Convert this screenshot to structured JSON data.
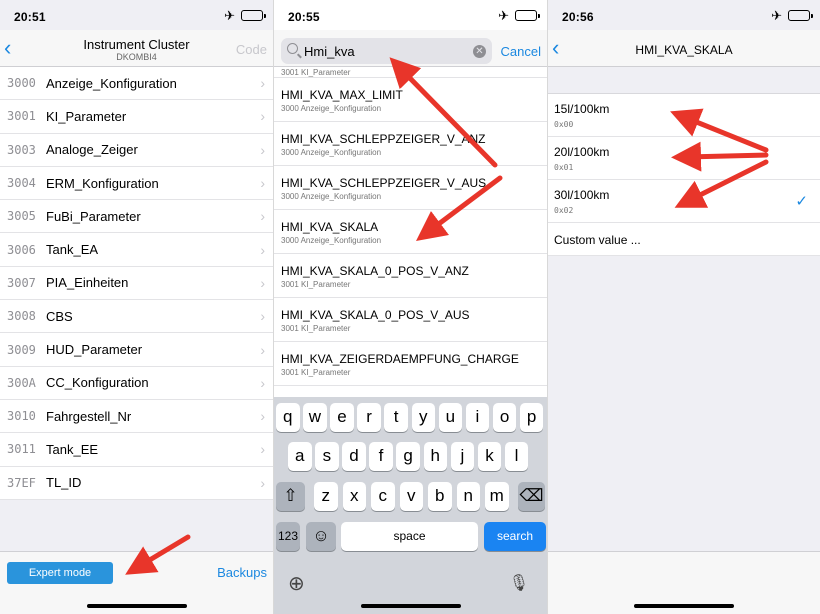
{
  "accent_color": "#1b88e0",
  "arrow_color": "#e8352a",
  "panel1": {
    "status_time": "20:51",
    "nav": {
      "back_icon": "chevron-left-icon",
      "title": "Instrument Cluster",
      "subtitle": "DKOMBI4",
      "code_label": "Code"
    },
    "items": [
      {
        "hex": "3000",
        "name": "Anzeige_Konfiguration"
      },
      {
        "hex": "3001",
        "name": "KI_Parameter"
      },
      {
        "hex": "3003",
        "name": "Analoge_Zeiger"
      },
      {
        "hex": "3004",
        "name": "ERM_Konfiguration"
      },
      {
        "hex": "3005",
        "name": "FuBi_Parameter"
      },
      {
        "hex": "3006",
        "name": "Tank_EA"
      },
      {
        "hex": "3007",
        "name": "PIA_Einheiten"
      },
      {
        "hex": "3008",
        "name": "CBS"
      },
      {
        "hex": "3009",
        "name": "HUD_Parameter"
      },
      {
        "hex": "300A",
        "name": "CC_Konfiguration"
      },
      {
        "hex": "3010",
        "name": "Fahrgestell_Nr"
      },
      {
        "hex": "3011",
        "name": "Tank_EE"
      },
      {
        "hex": "37EF",
        "name": "TL_ID"
      }
    ],
    "expert_label": "Expert mode",
    "backups_label": "Backups"
  },
  "panel2": {
    "status_time": "20:55",
    "search_value": "Hmi_kva",
    "cancel_label": "Cancel",
    "partial_desc": "3001 KI_Parameter",
    "results": [
      {
        "name": "HMI_KVA_MAX_LIMIT",
        "desc": "3000 Anzeige_Konfiguration"
      },
      {
        "name": "HMI_KVA_SCHLEPPZEIGER_V_ANZ",
        "desc": "3000 Anzeige_Konfiguration"
      },
      {
        "name": "HMI_KVA_SCHLEPPZEIGER_V_AUS",
        "desc": "3000 Anzeige_Konfiguration"
      },
      {
        "name": "HMI_KVA_SKALA",
        "desc": "3000 Anzeige_Konfiguration"
      },
      {
        "name": "HMI_KVA_SKALA_0_POS_V_ANZ",
        "desc": "3001 KI_Parameter"
      },
      {
        "name": "HMI_KVA_SKALA_0_POS_V_AUS",
        "desc": "3001 KI_Parameter"
      },
      {
        "name": "HMI_KVA_ZEIGERDAEMPFUNG_CHARGE",
        "desc": "3001 KI_Parameter"
      }
    ],
    "keyboard": {
      "row1": [
        "q",
        "w",
        "e",
        "r",
        "t",
        "y",
        "u",
        "i",
        "o",
        "p"
      ],
      "row2": [
        "a",
        "s",
        "d",
        "f",
        "g",
        "h",
        "j",
        "k",
        "l"
      ],
      "row3": [
        "z",
        "x",
        "c",
        "v",
        "b",
        "n",
        "m"
      ],
      "numbers_label": "123",
      "space_label": "space",
      "search_label": "search",
      "shift_icon": "shift-icon",
      "delete_icon": "delete-icon",
      "emoji_icon": "emoji-icon",
      "globe_icon": "globe-icon",
      "mic_icon": "microphone-icon"
    }
  },
  "panel3": {
    "status_time": "20:56",
    "nav": {
      "back_icon": "chevron-left-icon",
      "title": "HMI_KVA_SKALA"
    },
    "options": [
      {
        "value": "15l/100km",
        "hex": "0x00",
        "selected": false
      },
      {
        "value": "20l/100km",
        "hex": "0x01",
        "selected": false
      },
      {
        "value": "30l/100km",
        "hex": "0x02",
        "selected": true
      }
    ],
    "custom_label": "Custom value ..."
  }
}
